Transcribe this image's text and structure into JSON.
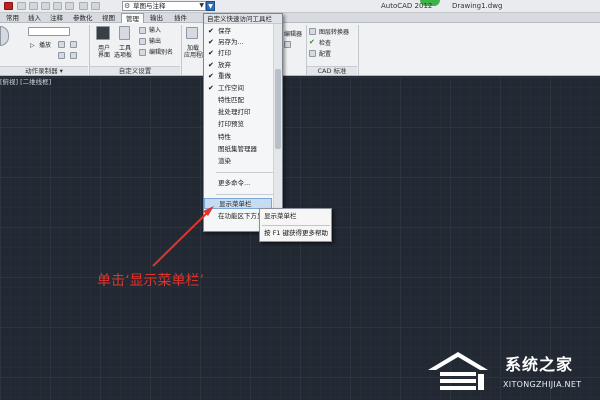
{
  "titlebar": {
    "workspace": "草图与注释",
    "app_title": "AutoCAD 2012",
    "doc_title": "Drawing1.dwg"
  },
  "tabs": [
    "常用",
    "插入",
    "注释",
    "参数化",
    "视图",
    "管理",
    "输出",
    "插件"
  ],
  "active_tab": "管理",
  "ribbon": {
    "play": "播放",
    "user_interface": "用户界面",
    "tool_palettes_l1": "工具",
    "tool_palettes_l2": "选项板",
    "import": "输入",
    "export": "输出",
    "edit_alias": "编辑别名",
    "load_app_l1": "加载",
    "load_app_l2": "应用程序",
    "panel_action_recorder": "动作录制器",
    "panel_customization": "自定义设置",
    "panel_cad_standards": "CAD 标准",
    "layer_translator": "图层转换器",
    "check": "检查",
    "configure": "配置",
    "edit_partial": "编辑器"
  },
  "viewport_label": "[俯视] [二维线框]",
  "qat_menu": {
    "header": "自定义快速访问工具栏",
    "items": [
      {
        "label": "保存",
        "checked": true
      },
      {
        "label": "另存为...",
        "checked": true
      },
      {
        "label": "打印",
        "checked": true
      },
      {
        "label": "放弃",
        "checked": true
      },
      {
        "label": "重做",
        "checked": true
      },
      {
        "label": "工作空间",
        "checked": true
      },
      {
        "label": "特性匹配",
        "checked": false
      },
      {
        "label": "批处理打印",
        "checked": false
      },
      {
        "label": "打印预览",
        "checked": false
      },
      {
        "label": "特性",
        "checked": false
      },
      {
        "label": "图纸集管理器",
        "checked": false
      },
      {
        "label": "渲染",
        "checked": false
      }
    ],
    "more_commands": "更多命令...",
    "show_menubar": "显示菜单栏",
    "show_below_ribbon": "在功能区下方显示"
  },
  "tooltip": {
    "title": "显示菜单栏",
    "help": "按 F1 键获得更多帮助"
  },
  "annotation": "单击‘显示菜单栏’",
  "watermark": {
    "name": "系统之家",
    "url": "XITONGZHIJIA.NET"
  },
  "colors": {
    "canvas": "#222933",
    "accent_red": "#e0342d",
    "highlight": "#c7dcf3"
  }
}
